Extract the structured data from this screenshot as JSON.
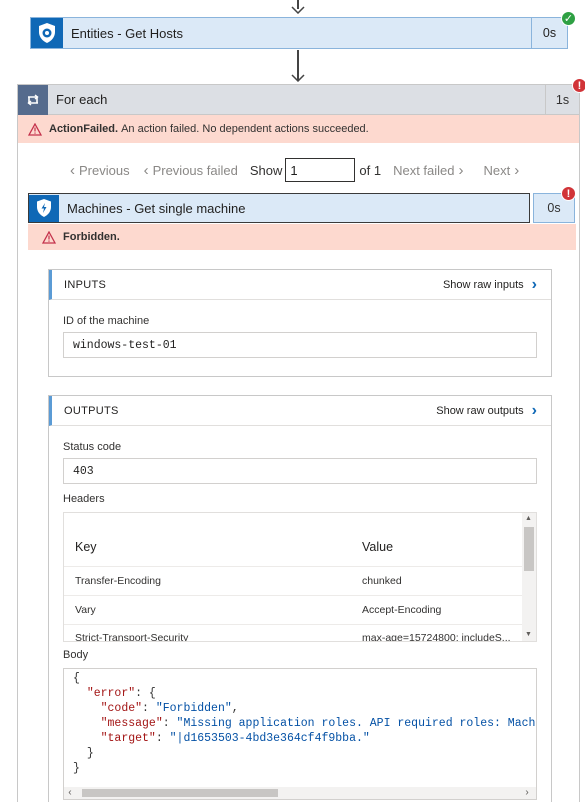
{
  "top_step": {
    "title": "Entities - Get Hosts",
    "duration": "0s",
    "status": "succeeded"
  },
  "foreach": {
    "title": "For each",
    "duration": "1s",
    "error_strong": "ActionFailed.",
    "error_text": "An action failed. No dependent actions succeeded."
  },
  "pager": {
    "previous": "Previous",
    "previous_failed": "Previous failed",
    "show": "Show",
    "current": "1",
    "of": "of 1",
    "next_failed": "Next failed",
    "next": "Next"
  },
  "inner_step": {
    "title": "Machines - Get single machine",
    "duration": "0s",
    "error": "Forbidden."
  },
  "inputs": {
    "title": "INPUTS",
    "raw_link": "Show raw inputs",
    "field_label": "ID of the machine",
    "field_value": "windows-test-01"
  },
  "outputs": {
    "title": "OUTPUTS",
    "raw_link": "Show raw outputs",
    "status_label": "Status code",
    "status_value": "403",
    "headers_label": "Headers",
    "headers_columns": [
      "Key",
      "Value"
    ],
    "headers_rows": [
      {
        "key": "Transfer-Encoding",
        "value": "chunked"
      },
      {
        "key": "Vary",
        "value": "Accept-Encoding"
      },
      {
        "key": "Strict-Transport-Security",
        "value": "max-age=15724800; includeS..."
      }
    ],
    "body_label": "Body",
    "body_lines": {
      "open": "{",
      "error_key": "\"error\"",
      "error_open": ": {",
      "code_key": "\"code\"",
      "code_val": "\"Forbidden\"",
      "message_key": "\"message\"",
      "message_val": "\"Missing application roles. API required roles: Mach",
      "target_key": "\"target\"",
      "target_val": "\"|d1653503-4bd3e364cf4f9bba.\"",
      "inner_close": "}",
      "close": "}"
    }
  },
  "colors": {
    "accent": "#0f68b6",
    "error_bg": "#fdd9cf",
    "error_dot": "#d13438",
    "success_dot": "#2ea043",
    "step_bg": "#dbe9f7"
  }
}
